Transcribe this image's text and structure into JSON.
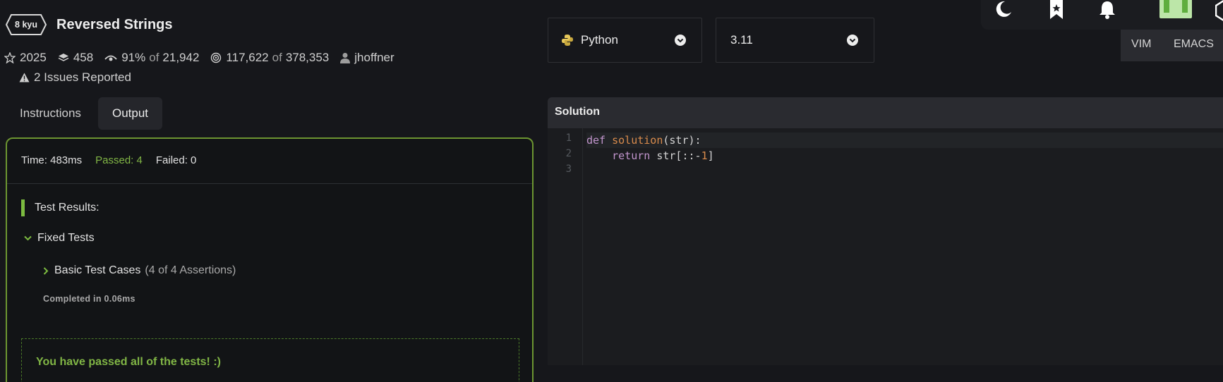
{
  "kata": {
    "rank": "8 kyu",
    "title": "Reversed Strings",
    "stars": "2025",
    "collections": "458",
    "satisfaction": "91%",
    "votes_of": "of",
    "votes": "21,942",
    "completed": "117,622",
    "attempts_of": "of",
    "attempts": "378,353",
    "author": "jhoffner",
    "issues": "2 Issues Reported"
  },
  "tabs": {
    "instructions": "Instructions",
    "output": "Output"
  },
  "output": {
    "time": "Time: 483ms",
    "passed": "Passed: 4",
    "failed": "Failed: 0",
    "results_title": "Test Results:",
    "fixed_tests": "Fixed Tests",
    "basic_cases": "Basic Test Cases",
    "assertions": "(4 of 4 Assertions)",
    "completed_in": "Completed in 0.06ms",
    "passed_message": "You have passed all of the tests! :)"
  },
  "selects": {
    "language": "Python",
    "version": "3.11"
  },
  "editor_modes": {
    "vim": "VIM",
    "emacs": "EMACS"
  },
  "solution": {
    "header": "Solution",
    "line_numbers": [
      "1",
      "2",
      "3"
    ],
    "line1": {
      "kw": "def",
      "fn": "solution",
      "rest": "(str):"
    },
    "line2": {
      "indent": "    ",
      "kw": "return",
      "rest": " str[::-",
      "num": "1",
      "close": "]"
    }
  },
  "colors": {
    "accent_green": "#80b545",
    "panel_border": "#6c9531",
    "background": "#16171b"
  },
  "icons": [
    "star-icon",
    "layers-icon",
    "eye-icon",
    "target-icon",
    "user-icon",
    "warning-icon",
    "chevron-down-icon",
    "chevron-right-icon",
    "python-icon",
    "moon-icon",
    "bookmark-icon",
    "bell-icon",
    "hex-icon"
  ]
}
